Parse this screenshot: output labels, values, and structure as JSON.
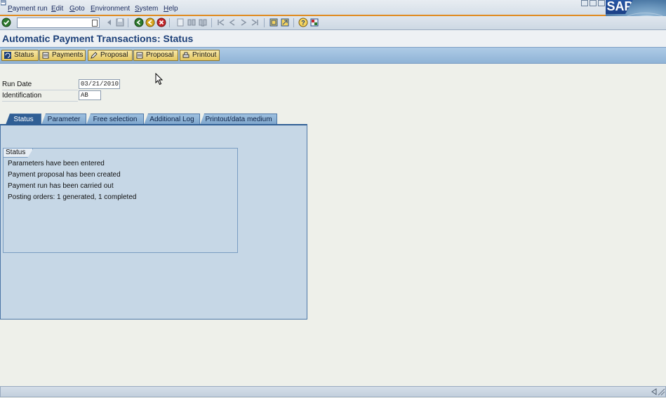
{
  "menubar": {
    "items": [
      "Payment run",
      "Edit",
      "Goto",
      "Environment",
      "System",
      "Help"
    ]
  },
  "logo": {
    "text": "SAP"
  },
  "page": {
    "title": "Automatic Payment Transactions: Status"
  },
  "app_toolbar": {
    "buttons": [
      "Status",
      "Payments",
      "Proposal",
      "Proposal",
      "Printout"
    ]
  },
  "fields": {
    "run_date": {
      "label": "Run Date",
      "value": "03/21/2010"
    },
    "identification": {
      "label": "Identification",
      "value": "AB"
    }
  },
  "tabs": [
    "Status",
    "Parameter",
    "Free selection",
    "Additional Log",
    "Printout/data medium"
  ],
  "active_tab": "Status",
  "status_group": {
    "title": "Status",
    "lines": [
      "Parameters have been entered",
      "Payment proposal has been created",
      "Payment run has been carried out",
      "Posting orders: 1 generated, 1 completed"
    ]
  },
  "colors": {
    "accent_orange": "#e08a1e",
    "title_blue": "#1c3f78",
    "active_tab": "#305f95",
    "panel_bg": "#c6d7e6",
    "button_yellow": "#e4c760"
  }
}
